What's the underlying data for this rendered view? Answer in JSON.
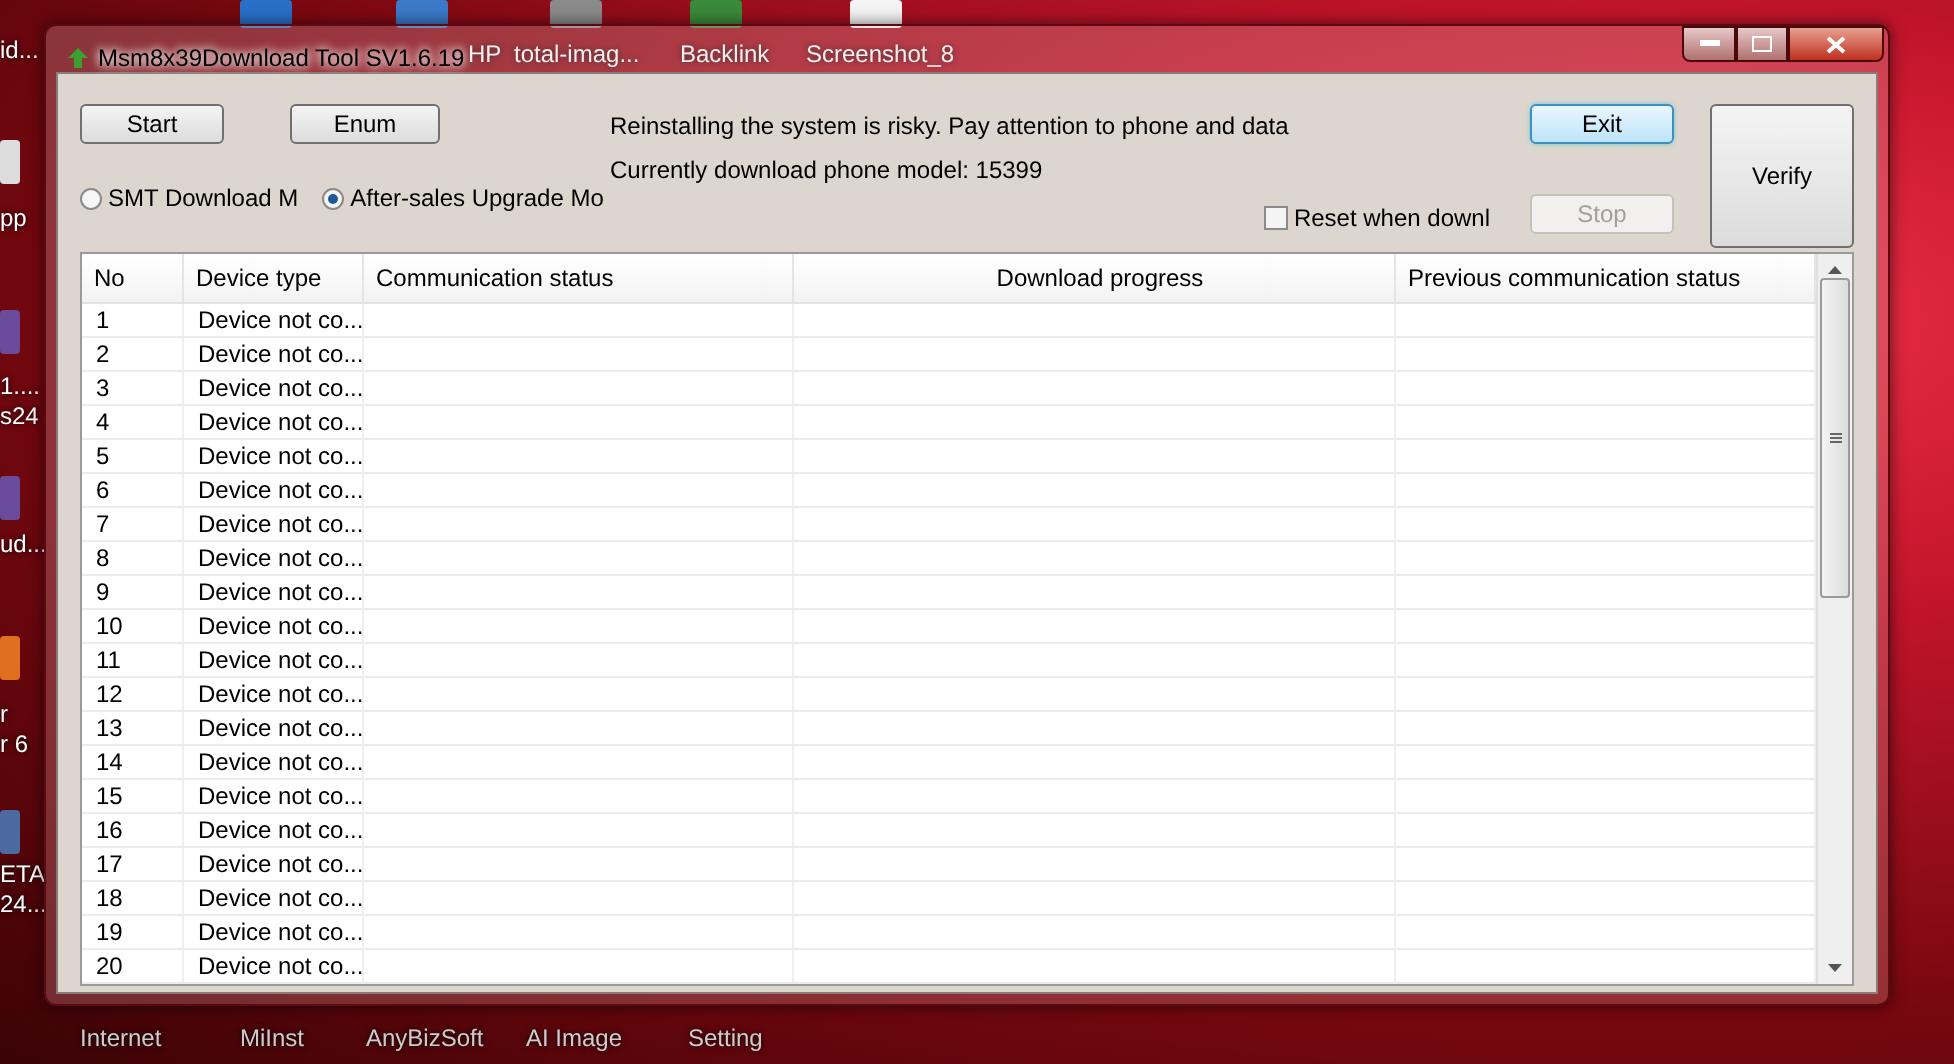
{
  "desktop": {
    "top_icons": [
      {
        "label": "HP"
      },
      {
        "label": "total-imag..."
      },
      {
        "label": "Backlink"
      },
      {
        "label": "Screenshot_8"
      }
    ],
    "left_icons": [
      {
        "lines": [
          "id..."
        ]
      },
      {
        "lines": [
          "pp"
        ]
      },
      {
        "lines": [
          "1....",
          "s24"
        ]
      },
      {
        "lines": [
          "ud..."
        ]
      },
      {
        "lines": [
          "r",
          "r 6"
        ]
      },
      {
        "lines": [
          "ETA",
          "24..."
        ]
      }
    ],
    "bottom_icons": [
      {
        "label": "Internet"
      },
      {
        "label": "MiInst"
      },
      {
        "label": "AnyBizSoft"
      },
      {
        "label": "AI Image"
      },
      {
        "label": "Setting"
      }
    ]
  },
  "window": {
    "title": "Msm8x39Download Tool SV1.6.19"
  },
  "toolbar": {
    "start": "Start",
    "enum": "Enum",
    "exit": "Exit",
    "stop": {
      "label": "Stop",
      "disabled": true
    },
    "verify": "Verify"
  },
  "modes": [
    {
      "label": "SMT Download M",
      "selected": false
    },
    {
      "label": "After-sales Upgrade Mo",
      "selected": true
    }
  ],
  "messages": [
    "Reinstalling the system is risky. Pay attention to phone and data",
    "Currently download phone model: 15399"
  ],
  "reset_option": {
    "label": "Reset when downl",
    "checked": false
  },
  "table": {
    "columns": [
      "No",
      "Device type",
      "Communication status",
      "Download progress",
      "Previous communication status"
    ],
    "rows": [
      {
        "no": "1",
        "device": "Device not co..."
      },
      {
        "no": "2",
        "device": "Device not co..."
      },
      {
        "no": "3",
        "device": "Device not co..."
      },
      {
        "no": "4",
        "device": "Device not co..."
      },
      {
        "no": "5",
        "device": "Device not co..."
      },
      {
        "no": "6",
        "device": "Device not co..."
      },
      {
        "no": "7",
        "device": "Device not co..."
      },
      {
        "no": "8",
        "device": "Device not co..."
      },
      {
        "no": "9",
        "device": "Device not co..."
      },
      {
        "no": "10",
        "device": "Device not co..."
      },
      {
        "no": "11",
        "device": "Device not co..."
      },
      {
        "no": "12",
        "device": "Device not co..."
      },
      {
        "no": "13",
        "device": "Device not co..."
      },
      {
        "no": "14",
        "device": "Device not co..."
      },
      {
        "no": "15",
        "device": "Device not co..."
      },
      {
        "no": "16",
        "device": "Device not co..."
      },
      {
        "no": "17",
        "device": "Device not co..."
      },
      {
        "no": "18",
        "device": "Device not co..."
      },
      {
        "no": "19",
        "device": "Device not co..."
      },
      {
        "no": "20",
        "device": "Device not co..."
      }
    ]
  }
}
